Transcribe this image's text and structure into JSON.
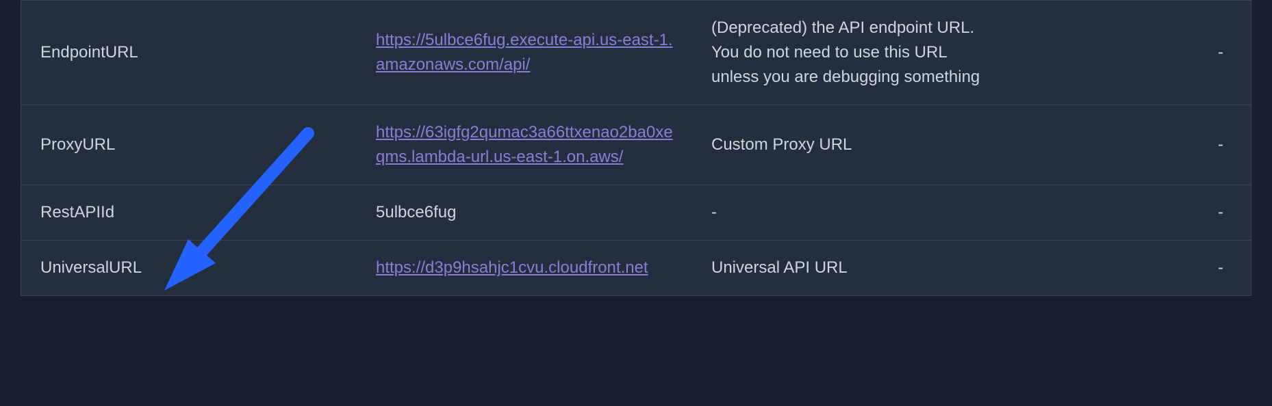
{
  "rows": [
    {
      "key": "EndpointURL",
      "value": "https://5ulbce6fug.execute-api.us-east-1.amazonaws.com/api/",
      "value_is_link": true,
      "description": "(Deprecated) the API endpoint URL. You do not need to use this URL unless you are debugging something",
      "last": "-"
    },
    {
      "key": "ProxyURL",
      "value": "https://63igfg2qumac3a66ttxenao2ba0xeqms.lambda-url.us-east-1.on.aws/",
      "value_is_link": true,
      "description": "Custom Proxy URL",
      "last": "-"
    },
    {
      "key": "RestAPIId",
      "value": "5ulbce6fug",
      "value_is_link": false,
      "description": "-",
      "last": "-"
    },
    {
      "key": "UniversalURL",
      "value": "https://d3p9hsahjc1cvu.cloudfront.net",
      "value_is_link": true,
      "description": "Universal API URL",
      "last": "-"
    }
  ],
  "annotation": {
    "arrow_color": "#2463ff"
  }
}
